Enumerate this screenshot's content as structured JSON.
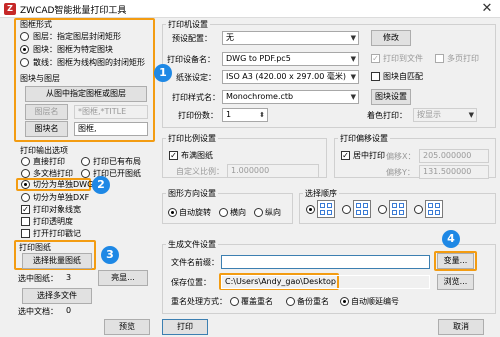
{
  "window": {
    "title": "ZWCAD智能批量打印工具",
    "close": "✕"
  },
  "shape": {
    "group_title": "图框形式",
    "rect": "图层：指定图层封闭矩形",
    "block": "图块：图框为特定图块",
    "polyline": "散线：图框为线构图的封闭矩形"
  },
  "blocklayer": {
    "group_title": "图块与图层",
    "pick_button": "从图中指定图框或图层",
    "layer_button": "图层名",
    "layer_value": "*图框,*TITLE",
    "block_button": "图块名",
    "block_value": "图框,"
  },
  "output": {
    "group_title": "打印输出选项",
    "direct": "直接打印",
    "to_file": "打印已有布局",
    "multi": "多文档打印",
    "opened": "打印已开图纸",
    "split_dwg": "切分为单独DWG",
    "split_dxf": "切分为单独DXF",
    "pen": "打印对象线宽",
    "transparency": "打印透明度",
    "stamp": "打开打印戳记"
  },
  "drawing": {
    "group_title": "打印图纸",
    "select_button": "选择批量图纸",
    "selected_label": "选中图纸：",
    "selected_count": "3",
    "highlight_button": "亮显...",
    "multi_file_button": "选择多文件",
    "selected_doc_label": "选中文档：",
    "selected_doc_count": "0",
    "preview_button": "预览"
  },
  "printer": {
    "group_title": "打印机设置",
    "preset_label": "预设配置：",
    "preset_value": "无",
    "modify_button": "修改",
    "device_label": "打印设备名：",
    "device_value": "DWG to PDF.pc5",
    "print_to_file": "打印到文件",
    "multi_page": "多页打印",
    "paper_label": "纸张设定：",
    "paper_value": "ISO A3 (420.00 x 297.00 毫米)",
    "auto_match": "图块自匹配",
    "style_label": "打印样式名：",
    "style_value": "Monochrome.ctb",
    "style_button": "图块设置",
    "copies_label": "打印份数：",
    "copies_value": "1",
    "color_label": "着色打印：",
    "color_value": "按显示"
  },
  "scale": {
    "group_title": "打印比例设置",
    "fit": "布满图纸",
    "custom_label": "自定义比例：",
    "custom_value": "1.000000"
  },
  "offset": {
    "group_title": "打印偏移设置",
    "center": "居中打印",
    "x_label": "偏移X：",
    "x_value": "205.000000",
    "y_label": "偏移Y：",
    "y_value": "131.500000"
  },
  "orient": {
    "group_title": "图形方向设置",
    "auto": "自动旋转",
    "landscape": "横向",
    "portrait": "纵向"
  },
  "order": {
    "group_title": "选择顺序"
  },
  "generate": {
    "group_title": "生成文件设置",
    "prefix_label": "文件名前缀：",
    "prefix_value": "",
    "var_button": "变量...",
    "path_label": "保存位置：",
    "path_value": "C:\\Users\\Andy_gao\\Desktop",
    "browse_button": "浏览...",
    "rename_label": "重名处理方式：",
    "overwrite": "覆盖重名",
    "backup": "备份重名",
    "auto_number": "自动顺延编号"
  },
  "footer": {
    "print_button": "打印",
    "cancel_button": "取消"
  },
  "badges": {
    "b1": "1",
    "b2": "2",
    "b3": "3",
    "b4": "4"
  }
}
